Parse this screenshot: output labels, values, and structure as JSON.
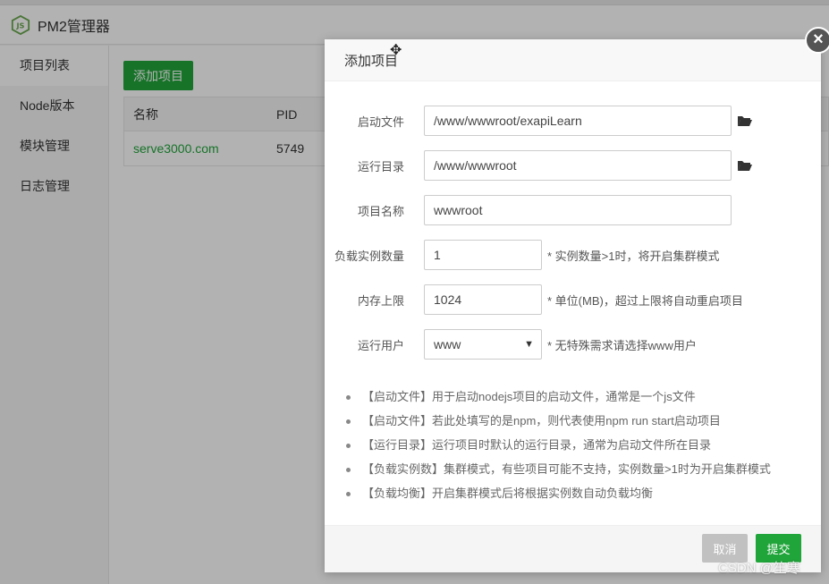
{
  "app": {
    "title": "PM2管理器",
    "sidebar": [
      "项目列表",
      "Node版本",
      "模块管理",
      "日志管理"
    ],
    "add_button": "添加项目",
    "table": {
      "headers": [
        "名称",
        "PID"
      ],
      "rows": [
        [
          "serve3000.com",
          "5749"
        ]
      ]
    }
  },
  "modal": {
    "title": "添加项目",
    "fields": {
      "start_file": {
        "label": "启动文件",
        "value": "/www/wwwroot/exapiLearn"
      },
      "run_dir": {
        "label": "运行目录",
        "value": "/www/wwwroot"
      },
      "project_name": {
        "label": "项目名称",
        "value": "wwwroot"
      },
      "instances": {
        "label": "负载实例数量",
        "value": "1",
        "hint": "* 实例数量>1时，将开启集群模式"
      },
      "memory": {
        "label": "内存上限",
        "value": "1024",
        "hint": "* 单位(MB)，超过上限将自动重启项目"
      },
      "run_user": {
        "label": "运行用户",
        "value": "www",
        "hint": "* 无特殊需求请选择www用户"
      }
    },
    "notes": [
      "【启动文件】用于启动nodejs项目的启动文件，通常是一个js文件",
      "【启动文件】若此处填写的是npm，则代表使用npm run start启动项目",
      "【运行目录】运行项目时默认的运行目录，通常为启动文件所在目录",
      "【负载实例数】集群模式，有些项目可能不支持，实例数量>1时为开启集群模式",
      "【负载均衡】开启集群模式后将根据实例数自动负载均衡"
    ],
    "cancel": "取消",
    "submit": "提交"
  },
  "watermark": "CSDN @笙寒",
  "colors": {
    "accent": "#20a53a",
    "cancel": "#c1c1c1"
  }
}
